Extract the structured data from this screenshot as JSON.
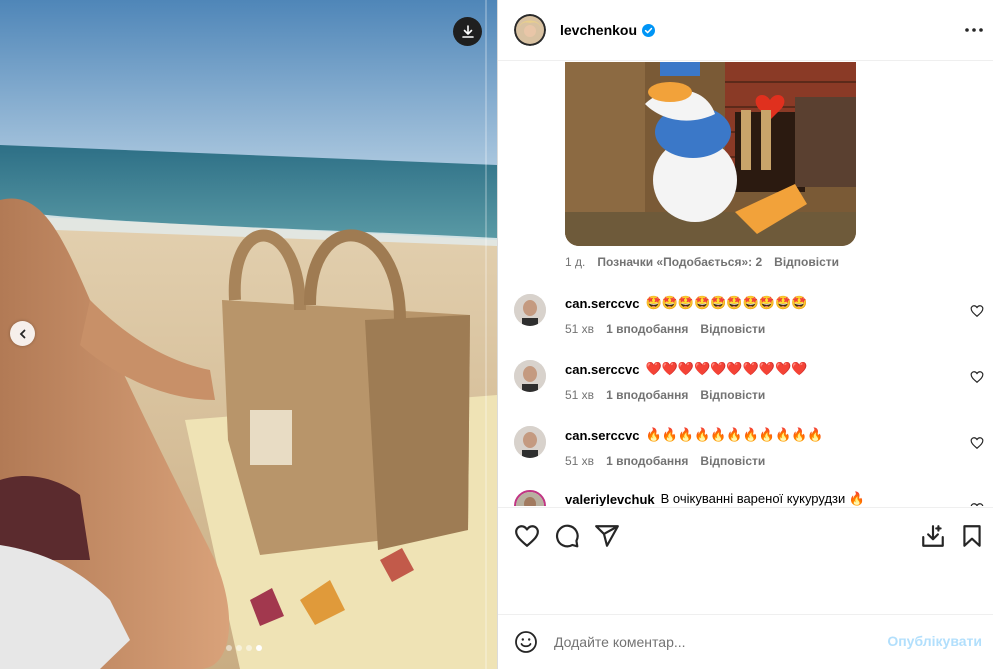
{
  "post": {
    "author": "levchenkou",
    "verified": true
  },
  "media": {
    "download_icon": "download-icon",
    "prev_icon": "chevron-left-icon",
    "carousel_count": 4,
    "carousel_active": 3
  },
  "reply_thread": {
    "time": "1 д.",
    "likes": "Позначки «Подобається»: 2",
    "reply": "Відповісти"
  },
  "comments": [
    {
      "user": "can.serccvc",
      "text": "🤩🤩🤩🤩🤩🤩🤩🤩🤩🤩",
      "time": "51 хв",
      "likes": "1 вподобання",
      "reply": "Відповісти"
    },
    {
      "user": "can.serccvc",
      "text": "❤️❤️❤️❤️❤️❤️❤️❤️❤️❤️",
      "time": "51 хв",
      "likes": "1 вподобання",
      "reply": "Відповісти"
    },
    {
      "user": "can.serccvc",
      "text": "🔥🔥🔥🔥🔥🔥🔥🔥🔥🔥🔥",
      "time": "51 хв",
      "likes": "1 вподобання",
      "reply": "Відповісти"
    },
    {
      "user": "valeriylevchuk",
      "text": "В очікуванні вареної кукурудзи 🔥"
    }
  ],
  "actions": {
    "like_icon": "heart-icon",
    "comment_icon": "comment-icon",
    "share_icon": "share-icon",
    "save_to_collection_icon": "download-tray-icon",
    "bookmark_icon": "bookmark-icon"
  },
  "composer": {
    "placeholder": "Додайте коментар...",
    "post_label": "Опублікувати"
  },
  "colors": {
    "verified": "#0095f6",
    "post_disabled": "#b2dffc",
    "muted_text": "#737373",
    "divider": "#efefef"
  }
}
